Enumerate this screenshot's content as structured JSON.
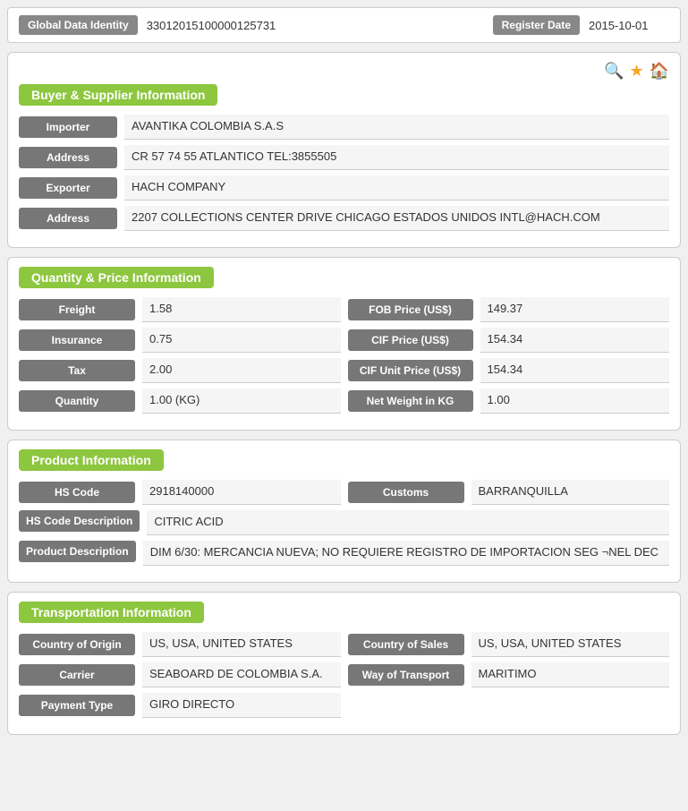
{
  "topBar": {
    "idLabel": "Global Data Identity",
    "idValue": "33012015100000125731",
    "regLabel": "Register Date",
    "regValue": "2015-10-01"
  },
  "buyerSupplier": {
    "header": "Buyer & Supplier Information",
    "fields": [
      {
        "label": "Importer",
        "value": "AVANTIKA COLOMBIA S.A.S"
      },
      {
        "label": "Address",
        "value": "CR 57 74 55 ATLANTICO TEL:3855505"
      },
      {
        "label": "Exporter",
        "value": "HACH COMPANY"
      },
      {
        "label": "Address",
        "value": "2207 COLLECTIONS CENTER DRIVE CHICAGO ESTADOS UNIDOS INTL@HACH.COM"
      }
    ]
  },
  "quantityPrice": {
    "header": "Quantity & Price Information",
    "leftFields": [
      {
        "label": "Freight",
        "value": "1.58"
      },
      {
        "label": "Insurance",
        "value": "0.75"
      },
      {
        "label": "Tax",
        "value": "2.00"
      },
      {
        "label": "Quantity",
        "value": "1.00 (KG)"
      }
    ],
    "rightFields": [
      {
        "label": "FOB Price (US$)",
        "value": "149.37"
      },
      {
        "label": "CIF Price (US$)",
        "value": "154.34"
      },
      {
        "label": "CIF Unit Price (US$)",
        "value": "154.34"
      },
      {
        "label": "Net Weight in KG",
        "value": "1.00"
      }
    ]
  },
  "product": {
    "header": "Product Information",
    "hsCode": "2918140000",
    "customs": "BARRANQUILLA",
    "hsCodeLabel": "HS Code",
    "customsLabel": "Customs",
    "hsDescLabel": "HS Code Description",
    "hsDescValue": "CITRIC ACID",
    "prodDescLabel": "Product Description",
    "prodDescValue": "DIM 6/30: MERCANCIA NUEVA; NO REQUIERE REGISTRO DE IMPORTACION SEG ¬NEL DEC"
  },
  "transport": {
    "header": "Transportation Information",
    "leftFields": [
      {
        "label": "Country of Origin",
        "value": "US, USA, UNITED STATES"
      },
      {
        "label": "Carrier",
        "value": "SEABOARD DE COLOMBIA S.A."
      },
      {
        "label": "Payment Type",
        "value": "GIRO DIRECTO"
      }
    ],
    "rightFields": [
      {
        "label": "Country of Sales",
        "value": "US, USA, UNITED STATES"
      },
      {
        "label": "Way of Transport",
        "value": "MARITIMO"
      }
    ]
  },
  "icons": {
    "search": "🔍",
    "star": "★",
    "home": "🏠"
  }
}
